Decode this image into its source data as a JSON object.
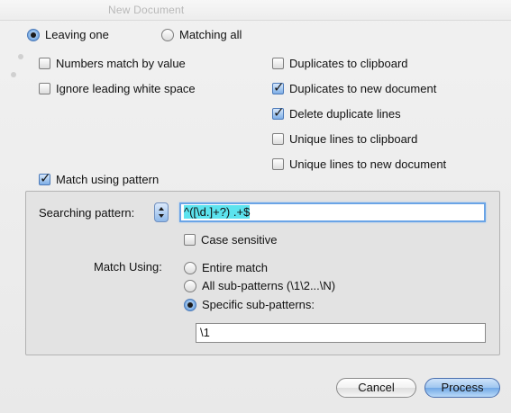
{
  "window": {
    "background_title": "New Document"
  },
  "mode": {
    "options": [
      {
        "label": "Leaving one",
        "selected": true
      },
      {
        "label": "Matching all",
        "selected": false
      }
    ]
  },
  "options_left": [
    {
      "label": "Numbers match by value",
      "checked": false
    },
    {
      "label": "Ignore leading white space",
      "checked": false
    }
  ],
  "options_right": [
    {
      "label": "Duplicates to clipboard",
      "checked": false
    },
    {
      "label": "Duplicates to new document",
      "checked": true
    },
    {
      "label": "Delete duplicate lines",
      "checked": true
    },
    {
      "label": "Unique lines to clipboard",
      "checked": false
    },
    {
      "label": "Unique lines to new document",
      "checked": false
    }
  ],
  "pattern": {
    "match_using_pattern": {
      "label": "Match using pattern",
      "checked": true
    },
    "searching_label": "Searching pattern:",
    "searching_value": "^([\\d.]+?) .+$",
    "case_sensitive": {
      "label": "Case sensitive",
      "checked": false
    },
    "match_using_label": "Match Using:",
    "match_options": [
      {
        "label": "Entire match",
        "selected": false
      },
      {
        "label": "All sub-patterns (\\1\\2...\\N)",
        "selected": false
      },
      {
        "label": "Specific sub-patterns:",
        "selected": true
      }
    ],
    "sub_pattern_value": "\\1"
  },
  "buttons": {
    "cancel": "Cancel",
    "process": "Process"
  },
  "colors": {
    "selection_highlight": "#5ce3ee",
    "accent": "#72a8e6"
  }
}
